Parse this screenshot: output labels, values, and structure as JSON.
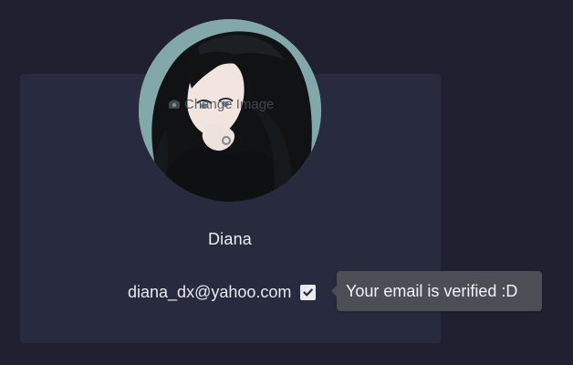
{
  "profile": {
    "change_image_label": "Change Image",
    "name": "Diana",
    "email": "diana_dx@yahoo.com",
    "verified_tooltip": "Your email is verified :D",
    "verified": true
  },
  "icons": {
    "camera": "camera-icon",
    "check": "checkbox-checked-icon"
  },
  "colors": {
    "page_background": "#202030",
    "card_background": "#282a3d",
    "tooltip_background": "#4b4f55",
    "text": "#e9e9ef"
  }
}
